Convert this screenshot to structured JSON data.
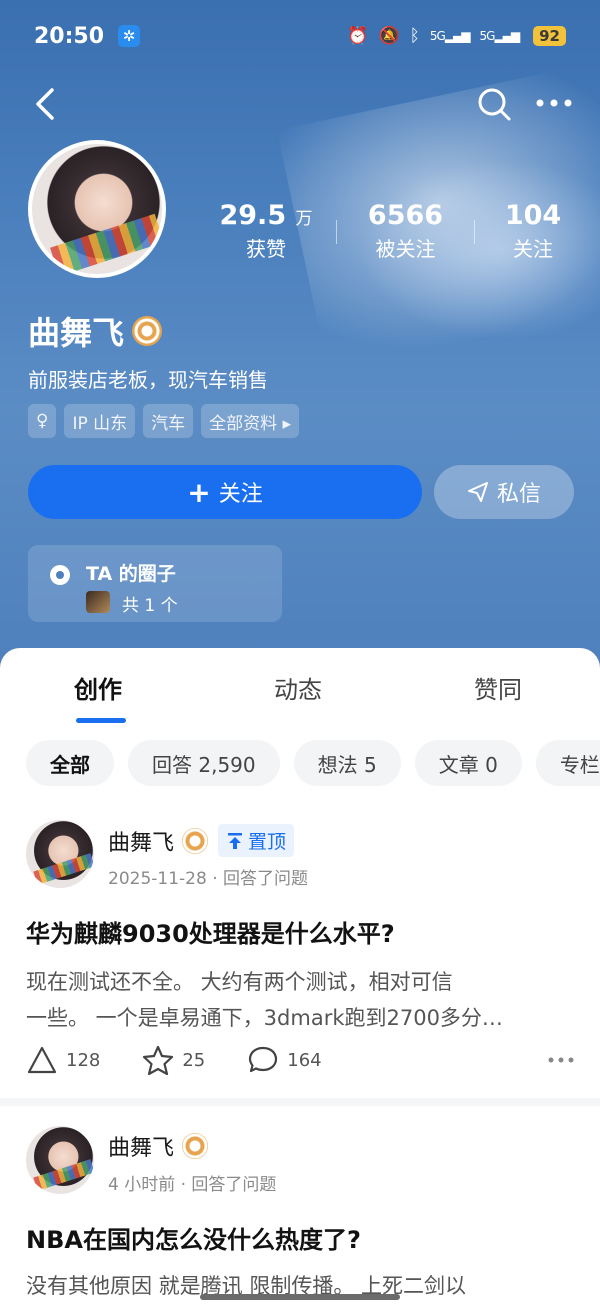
{
  "status_bar": {
    "time": "20:50",
    "network_left": "5G",
    "network_right": "5G",
    "battery": "92"
  },
  "profile": {
    "name": "曲舞飞",
    "bio": "前服装店老板，现汽车销售",
    "stats": [
      {
        "value": "29.5",
        "unit": "万",
        "label": "获赞"
      },
      {
        "value": "6566",
        "unit": "",
        "label": "被关注"
      },
      {
        "value": "104",
        "unit": "",
        "label": "关注"
      }
    ],
    "tags": [
      {
        "text": "♀"
      },
      {
        "text": "IP 山东"
      },
      {
        "text": "汽车"
      },
      {
        "text": "全部资料 ▸"
      }
    ],
    "follow_label": "关注",
    "message_label": "私信",
    "circle": {
      "title": "TA 的圈子",
      "count": "共 1 个"
    }
  },
  "tabs": [
    {
      "label": "创作",
      "active": true
    },
    {
      "label": "动态",
      "active": false
    },
    {
      "label": "赞同",
      "active": false
    }
  ],
  "chips": [
    {
      "label": "全部",
      "active": true
    },
    {
      "label": "回答 2,590",
      "active": false
    },
    {
      "label": "想法 5",
      "active": false
    },
    {
      "label": "文章 0",
      "active": false
    },
    {
      "label": "专栏",
      "active": false
    }
  ],
  "posts": [
    {
      "author": "曲舞飞",
      "pinned_label": "置顶",
      "meta": "2025-11-28 · 回答了问题",
      "title": "华为麒麟9030处理器是什么水平?",
      "body_line1": "现在测试还不全。 大约有两个测试，相对可信",
      "body_line2": "一些。 一个是卓易通下，3dmark跑到2700多分…",
      "likes": "128",
      "stars": "25",
      "comments": "164"
    },
    {
      "author": "曲舞飞",
      "meta": "4 小时前 · 回答了问题",
      "title": "NBA在国内怎么没什么热度了?",
      "body_line1": "没有其他原因 就是腾讯 限制传播。 上死二剑以"
    }
  ],
  "colors": {
    "accent": "#1a6ff0",
    "header_bg": "#4a7fbd",
    "badge": "#e7a44f"
  }
}
